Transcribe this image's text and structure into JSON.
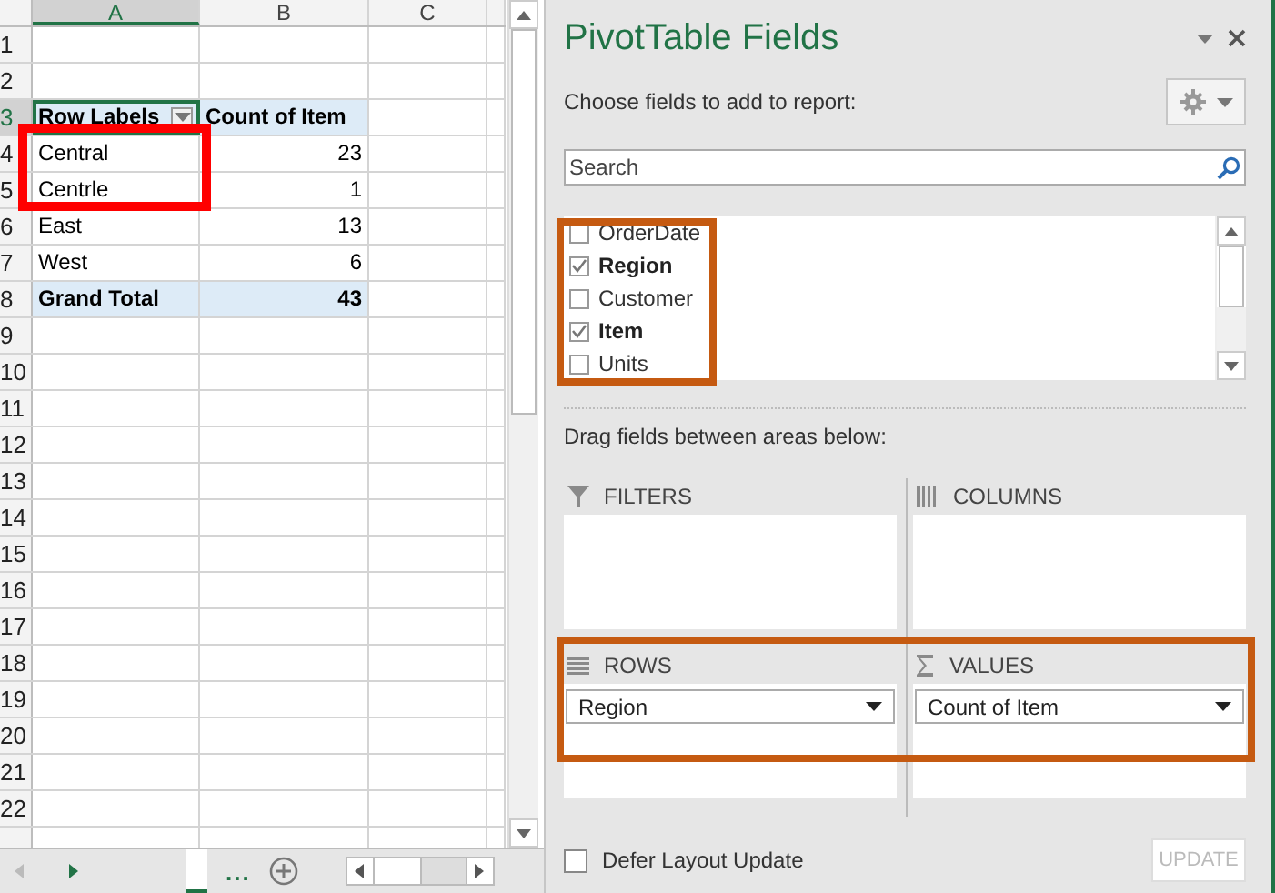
{
  "sheet": {
    "columns": [
      {
        "label": "A",
        "selected": true
      },
      {
        "label": "B",
        "selected": false
      },
      {
        "label": "C",
        "selected": false
      }
    ],
    "row_numbers": [
      {
        "label": "1",
        "selected": false
      },
      {
        "label": "2",
        "selected": false
      },
      {
        "label": "3",
        "selected": true
      },
      {
        "label": "4",
        "selected": false
      },
      {
        "label": "5",
        "selected": false
      },
      {
        "label": "6",
        "selected": false
      },
      {
        "label": "7",
        "selected": false
      },
      {
        "label": "8",
        "selected": false
      },
      {
        "label": "9",
        "selected": false
      },
      {
        "label": "10",
        "selected": false
      },
      {
        "label": "11",
        "selected": false
      },
      {
        "label": "12",
        "selected": false
      },
      {
        "label": "13",
        "selected": false
      },
      {
        "label": "14",
        "selected": false
      },
      {
        "label": "15",
        "selected": false
      },
      {
        "label": "16",
        "selected": false
      },
      {
        "label": "17",
        "selected": false
      },
      {
        "label": "18",
        "selected": false
      },
      {
        "label": "19",
        "selected": false
      },
      {
        "label": "20",
        "selected": false
      },
      {
        "label": "21",
        "selected": false
      },
      {
        "label": "22",
        "selected": false
      }
    ],
    "pivot": [
      {
        "kind": "header",
        "label": "Row Labels",
        "value": "Count of Item"
      },
      {
        "kind": "item",
        "label": "Central",
        "value": "23"
      },
      {
        "kind": "item",
        "label": "Centrle",
        "value": "1"
      },
      {
        "kind": "item",
        "label": "East",
        "value": "13"
      },
      {
        "kind": "item",
        "label": "West",
        "value": "6"
      },
      {
        "kind": "total",
        "label": "Grand Total",
        "value": "43"
      }
    ],
    "sheet_tabs_more": "..."
  },
  "panel": {
    "title": "PivotTable Fields",
    "subtitle": "Choose fields to add to report:",
    "search": {
      "placeholder": "Search"
    },
    "fields": [
      {
        "label": "OrderDate",
        "checked": false
      },
      {
        "label": "Region",
        "checked": true
      },
      {
        "label": "Customer",
        "checked": false
      },
      {
        "label": "Item",
        "checked": true
      },
      {
        "label": "Units",
        "checked": false
      }
    ],
    "areas_hint": "Drag fields between areas below:",
    "areas": [
      {
        "kind": "filters",
        "label": "FILTERS"
      },
      {
        "kind": "columns",
        "label": "COLUMNS"
      },
      {
        "kind": "rows",
        "label": "ROWS",
        "items": [
          "Region"
        ]
      },
      {
        "kind": "values",
        "label": "VALUES",
        "items": [
          "Count of Item"
        ]
      }
    ],
    "defer": {
      "label": "Defer Layout Update",
      "checked": false
    },
    "update_button": {
      "label": "UPDATE",
      "disabled": true
    }
  }
}
